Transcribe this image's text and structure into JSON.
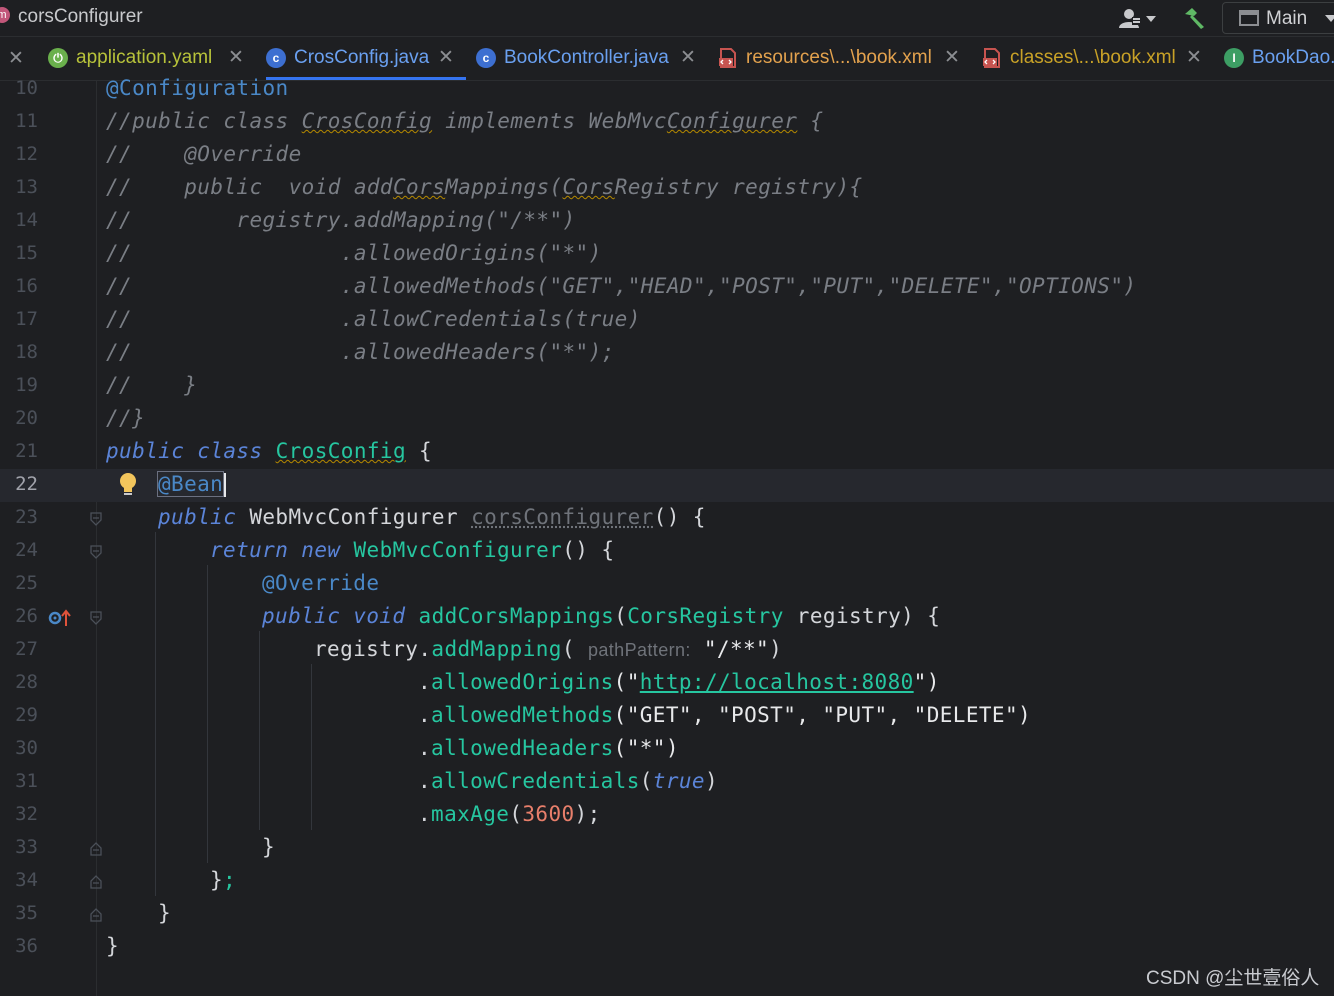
{
  "titlebar": {
    "project_name": "corsConfigurer",
    "project_icon_letter": "m",
    "run_config": "Main"
  },
  "tabs": [
    {
      "label": "application.yaml",
      "icon": "spring-boot-icon",
      "color": "#b7c23a",
      "active": false
    },
    {
      "label": "CrosConfig.java",
      "icon": "java-class-icon",
      "color": "#6aa0f0",
      "active": true
    },
    {
      "label": "BookController.java",
      "icon": "java-class-icon",
      "color": "#6aa0f0",
      "active": false
    },
    {
      "label": "resources\\...\\book.xml",
      "icon": "xml-file-icon",
      "color": "#e3a24e",
      "active": false
    },
    {
      "label": "classes\\...\\book.xml",
      "icon": "xml-file-icon",
      "color": "#c9a227",
      "active": false
    },
    {
      "label": "BookDao.",
      "icon": "java-interface-icon",
      "color": "#6aa0f0",
      "active": false
    }
  ],
  "editor": {
    "line_numbers": [
      "10",
      "11",
      "12",
      "13",
      "14",
      "15",
      "16",
      "17",
      "18",
      "19",
      "20",
      "21",
      "22",
      "23",
      "24",
      "25",
      "26",
      "27",
      "28",
      "29",
      "30",
      "31",
      "32",
      "33",
      "34",
      "35",
      "36"
    ],
    "current_line": "22",
    "tokens": {
      "l10": "@Configuration",
      "l11a": "//public class ",
      "l11b": "CrosConfig",
      "l11c": " implements WebMvc",
      "l11d": "Configurer",
      "l11e": " {",
      "l12": "//    @Override",
      "l13a": "//    public  void add",
      "l13b": "Cors",
      "l13c": "Mappings(",
      "l13d": "Cors",
      "l13e": "Registry registry){",
      "l14": "//        registry.addMapping(\"/**\")",
      "l15": "//                .allowedOrigins(\"*\")",
      "l16": "//                .allowedMethods(\"GET\",\"HEAD\",\"POST\",\"PUT\",\"DELETE\",\"OPTIONS\")",
      "l17": "//                .allowCredentials(true)",
      "l18": "//                .allowedHeaders(\"*\");",
      "l19": "//    }",
      "l20": "//}",
      "l21_kw": "public class ",
      "l21_name": "CrosConfig",
      "l21_rest": " {",
      "l22": "@Bean",
      "l23_kw": "public ",
      "l23_type": "WebMvcConfigurer",
      "l23_name": "corsConfigurer",
      "l23_rest": "() {",
      "l24_kw": "return new ",
      "l24_type": "WebMvcConfigurer",
      "l24_rest": "() {",
      "l25": "@Override",
      "l26_kw": "public void ",
      "l26_fn": "addCorsMappings",
      "l26_p1": "(",
      "l26_type": "CorsRegistry",
      "l26_rest": " registry) {",
      "l27_id": "registry",
      "l27_dot": ".",
      "l27_fn": "addMapping",
      "l27_p": "( ",
      "l27_hint": "pathPattern:",
      "l27_str": " \"/**\"",
      "l27_close": ")",
      "l28_dot": ".",
      "l28_fn": "allowedOrigins",
      "l28_p": "(\"",
      "l28_url": "http://localhost:8080",
      "l28_close": "\")",
      "l29_dot": ".",
      "l29_fn": "allowedMethods",
      "l29_args": "(\"GET\", \"POST\", \"PUT\", \"DELETE\")",
      "l30_dot": ".",
      "l30_fn": "allowedHeaders",
      "l30_args": "(\"*\")",
      "l31_dot": ".",
      "l31_fn": "allowCredentials",
      "l31_p": "(",
      "l31_kw": "true",
      "l31_close": ")",
      "l32_dot": ".",
      "l32_fn": "maxAge",
      "l32_p": "(",
      "l32_num": "3600",
      "l32_close": ");",
      "l33": "}",
      "l34_a": "}",
      "l34_b": ";",
      "l35": "}",
      "l36": "}"
    }
  },
  "watermark": "CSDN @尘世壹俗人"
}
